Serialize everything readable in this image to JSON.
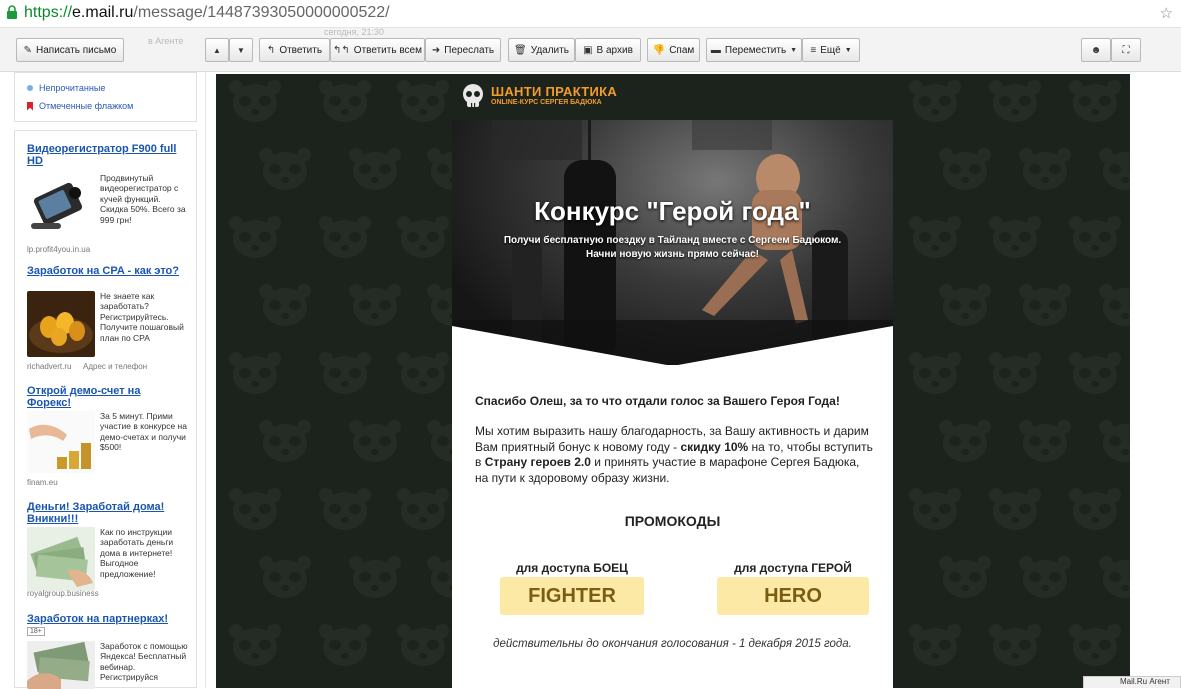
{
  "browser": {
    "url_scheme": "https://",
    "url_host": "e.mail.ru",
    "url_path": "/message/14487393050000000522/"
  },
  "toolbar": {
    "compose": "Написать письмо",
    "ghost_left": "в Агенте",
    "ghost_right": "сегодня, 21:30",
    "reply": "Ответить",
    "reply_all": "Ответить всем",
    "forward": "Переслать",
    "delete": "Удалить",
    "archive": "В архив",
    "spam": "Спам",
    "move": "Переместить",
    "more": "Ещё"
  },
  "sidebar": {
    "folders": [
      {
        "label": "Непрочитанные"
      },
      {
        "label": "Отмеченные флажком"
      }
    ],
    "ads": [
      {
        "title": "Видеорегистратор F900 full HD",
        "text": "Продвинутый видеорегистратор с кучей функций. Скидка 50%. Всего за 999 грн!",
        "source": "lp.profit4you.in.ua"
      },
      {
        "title": "Заработок на CPA - как это?",
        "text": "Не знаете как заработать? Регистрируйтесь. Получите пошаговый план по CPA",
        "source": "richadvert.ru",
        "source2": "Адрес и телефон"
      },
      {
        "title": "Открой демо-счет на Форекс!",
        "text": "За 5 минут. Прими участие в конкурсе на демо-счетах и получи $500!",
        "source": "finam.eu"
      },
      {
        "title": "Деньги! Заработай дома! Вникни!!!",
        "text": "Как по инструкции заработать деньги дома в интернете! Выгодное предложение!",
        "source": "royalgroup.business"
      },
      {
        "title": "Заработок на партнерках!",
        "age": "18+",
        "text": "Заработок с помощью Яндекса! Бесплатный вебинар. Регистрируйся"
      }
    ]
  },
  "email": {
    "logo_title": "ШАНТИ ПРАКТИКА",
    "logo_sub": "ONLINE-КУРС СЕРГЕЯ БАДЮКА",
    "hero_title": "Конкурс \"Герой года\"",
    "hero_sub1": "Получи бесплатную поездку в Тайланд вместе с Сергеем Бадюком.",
    "hero_sub2": "Начни новую жизнь прямо сейчас!",
    "thanks": "Спасибо Олеш, за то что отдали голос за Вашего Героя Года!",
    "body_p1": "Мы хотим выразить нашу благодарность, за Вашу активность и дарим Вам приятный бонус к новому году - ",
    "body_discount": "скидку 10%",
    "body_p2": " на то, чтобы вступить в ",
    "body_country": "Страну героев 2.0",
    "body_p3": " и принять участие в марафоне Сергея Бадюка, на пути к здоровому образу жизни.",
    "promo_heading": "ПРОМОКОДЫ",
    "promo": [
      {
        "label": "для доступа БОЕЦ",
        "code": "FIGHTER"
      },
      {
        "label": "для доступа ГЕРОЙ",
        "code": "HERO"
      }
    ],
    "valid_until": "действительны до окончания голосования - 1 декабря 2015 года."
  },
  "bottom_tab": "Mail.Ru Агент",
  "colors": {
    "accent_orange": "#f29c2a",
    "promo_bg": "#fde9a6",
    "link_blue": "#1a55b0",
    "email_bg": "#1c231d"
  }
}
